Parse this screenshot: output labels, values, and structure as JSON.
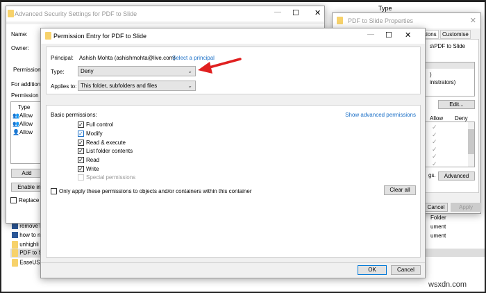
{
  "explorer": {
    "column_type": "Type",
    "items": [
      "remove b",
      "how to n",
      "unhighli",
      "PDF to Sl",
      "EaseUS_F"
    ],
    "types": [
      "Folder",
      "ument",
      "ument"
    ]
  },
  "advanced": {
    "title": "Advanced Security Settings for PDF to Slide",
    "name_label": "Name:",
    "owner_label": "Owner:",
    "tab": "Permissions",
    "for_additional": "For additiona",
    "perm_entries": "Permission e",
    "col_type": "Type",
    "rows": [
      "Allow",
      "Allow",
      "Allow"
    ],
    "add": "Add",
    "enable_inh": "Enable inh",
    "replace_all": "Replace all"
  },
  "props": {
    "title": "PDF to Slide Properties",
    "tabs": [
      "sions",
      "Customise"
    ],
    "path": "s\\PDF to Slide",
    "group_items": [
      ")",
      "inistrators)"
    ],
    "edit": "Edit...",
    "allow": "Allow",
    "deny": "Deny",
    "gs": "gs.",
    "advanced": "Advanced",
    "cancel": "Cancel",
    "apply": "Apply"
  },
  "entry": {
    "title": "Permission Entry for PDF to Slide",
    "principal_label": "Principal:",
    "principal": "Ashish Mohta (ashishmohta@live.com)",
    "select_principal": "Select a principal",
    "type_label": "Type:",
    "type_value": "Deny",
    "applies_label": "Applies to:",
    "applies_value": "This folder, subfolders and files",
    "basic_label": "Basic permissions:",
    "show_advanced": "Show advanced permissions",
    "permissions": [
      {
        "label": "Full control",
        "checked": true
      },
      {
        "label": "Modify",
        "checked": true
      },
      {
        "label": "Read & execute",
        "checked": true
      },
      {
        "label": "List folder contents",
        "checked": true
      },
      {
        "label": "Read",
        "checked": true
      },
      {
        "label": "Write",
        "checked": true
      },
      {
        "label": "Special permissions",
        "checked": false,
        "disabled": true
      }
    ],
    "only_apply": "Only apply these permissions to objects and/or containers within this container",
    "clear_all": "Clear all",
    "ok": "OK",
    "cancel": "Cancel"
  },
  "watermark": "wsxdn.com",
  "colors": {
    "accent": "#1a6fc7",
    "arrow": "#e02020"
  }
}
